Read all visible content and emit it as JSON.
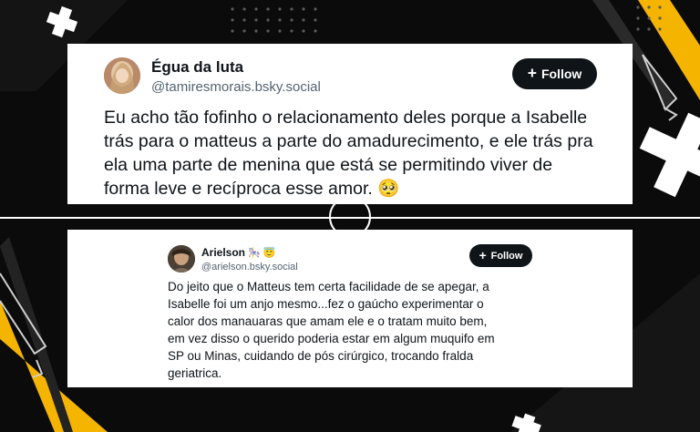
{
  "posts": [
    {
      "display_name": "Égua da luta",
      "handle": "@tamiresmorais.bsky.social",
      "follow_label": "Follow",
      "text": "Eu acho tão fofinho o relacionamento deles porque a Isabelle\ntrás para o matteus a parte do amadurecimento, e ele trás pra\nela uma parte de menina que está se permitindo viver de\nforma leve e recíproca esse amor.",
      "trailing_emoji": "🥺"
    },
    {
      "display_name": "Arielson",
      "name_emojis": "🎠 😇",
      "handle": "@arielson.bsky.social",
      "follow_label": "Follow",
      "text": "Do jeito que o Matteus tem certa facilidade de se apegar, a\nIsabelle foi um anjo mesmo...fez o gaúcho experimentar o\ncalor dos manauaras que amam ele e o tratam muito bem,\nem vez disso o querido poderia estar em algum muquifo em\nSP ou Minas, cuidando de pós cirúrgico, trocando fralda\ngeriatrica."
    }
  ],
  "colors": {
    "background": "#0b0b0b",
    "accent_yellow": "#f5b400",
    "card": "#ffffff",
    "text": "#0f1419",
    "muted": "#536471",
    "button": "#0f1419"
  }
}
